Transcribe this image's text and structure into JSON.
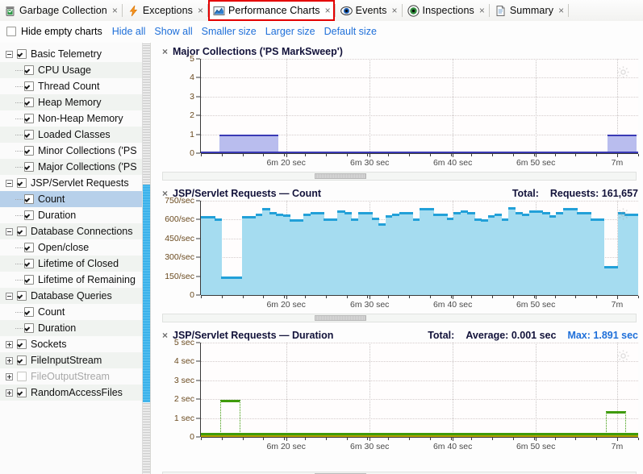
{
  "tabs": [
    {
      "label": "Garbage Collection",
      "icon": "trash-icon",
      "close": "×",
      "selected": false
    },
    {
      "label": "Exceptions",
      "icon": "bolt-icon",
      "close": "×",
      "selected": false
    },
    {
      "label": "Performance Charts",
      "icon": "chart-icon",
      "close": "×",
      "selected": true
    },
    {
      "label": "Events",
      "icon": "eye-icon",
      "close": "×",
      "selected": false
    },
    {
      "label": "Inspections",
      "icon": "eye-green-icon",
      "close": "×",
      "selected": false
    },
    {
      "label": "Summary",
      "icon": "document-icon",
      "close": "×",
      "selected": false
    }
  ],
  "toolbar": {
    "hide_empty_label": "Hide empty charts",
    "hide_empty_checked": false,
    "links": [
      "Hide all",
      "Show all",
      "Smaller size",
      "Larger size",
      "Default size"
    ]
  },
  "sidebar": {
    "rows": [
      {
        "label": "Basic Telemetry",
        "indent": 0,
        "twisty": "minus",
        "checked": true,
        "selected": false,
        "disabled": false
      },
      {
        "label": "CPU Usage",
        "indent": 1,
        "twisty": "none",
        "checked": true,
        "selected": false,
        "disabled": false
      },
      {
        "label": "Thread Count",
        "indent": 1,
        "twisty": "none",
        "checked": true,
        "selected": false,
        "disabled": false
      },
      {
        "label": "Heap Memory",
        "indent": 1,
        "twisty": "none",
        "checked": true,
        "selected": false,
        "disabled": false
      },
      {
        "label": "Non-Heap Memory",
        "indent": 1,
        "twisty": "none",
        "checked": true,
        "selected": false,
        "disabled": false
      },
      {
        "label": "Loaded Classes",
        "indent": 1,
        "twisty": "none",
        "checked": true,
        "selected": false,
        "disabled": false
      },
      {
        "label": "Minor Collections ('PS",
        "indent": 1,
        "twisty": "none",
        "checked": true,
        "selected": false,
        "disabled": false
      },
      {
        "label": "Major Collections ('PS",
        "indent": 1,
        "twisty": "none",
        "checked": true,
        "selected": false,
        "disabled": false
      },
      {
        "label": "JSP/Servlet Requests",
        "indent": 0,
        "twisty": "minus",
        "checked": true,
        "selected": false,
        "disabled": false
      },
      {
        "label": "Count",
        "indent": 1,
        "twisty": "none",
        "checked": true,
        "selected": true,
        "disabled": false
      },
      {
        "label": "Duration",
        "indent": 1,
        "twisty": "none",
        "checked": true,
        "selected": false,
        "disabled": false
      },
      {
        "label": "Database Connections",
        "indent": 0,
        "twisty": "minus",
        "checked": true,
        "selected": false,
        "disabled": false
      },
      {
        "label": "Open/close",
        "indent": 1,
        "twisty": "none",
        "checked": true,
        "selected": false,
        "disabled": false
      },
      {
        "label": "Lifetime of Closed",
        "indent": 1,
        "twisty": "none",
        "checked": true,
        "selected": false,
        "disabled": false
      },
      {
        "label": "Lifetime of Remaining",
        "indent": 1,
        "twisty": "none",
        "checked": true,
        "selected": false,
        "disabled": false
      },
      {
        "label": "Database Queries",
        "indent": 0,
        "twisty": "minus",
        "checked": true,
        "selected": false,
        "disabled": false
      },
      {
        "label": "Count",
        "indent": 1,
        "twisty": "none",
        "checked": true,
        "selected": false,
        "disabled": false
      },
      {
        "label": "Duration",
        "indent": 1,
        "twisty": "none",
        "checked": true,
        "selected": false,
        "disabled": false
      },
      {
        "label": "Sockets",
        "indent": 0,
        "twisty": "plus",
        "checked": true,
        "selected": false,
        "disabled": false
      },
      {
        "label": "FileInputStream",
        "indent": 0,
        "twisty": "plus",
        "checked": true,
        "selected": false,
        "disabled": false
      },
      {
        "label": "FileOutputStream",
        "indent": 0,
        "twisty": "plus",
        "checked": false,
        "selected": false,
        "disabled": true
      },
      {
        "label": "RandomAccessFiles",
        "indent": 0,
        "twisty": "plus",
        "checked": true,
        "selected": false,
        "disabled": false
      }
    ]
  },
  "chart_data": [
    {
      "type": "bar",
      "title": "Major Collections ('PS MarkSweep')",
      "close_icon": "×",
      "gear_icon": "gear-icon",
      "header_right": [],
      "xlabel": "",
      "ylabel": "",
      "ylim": [
        0,
        5
      ],
      "yticks": [
        0,
        1,
        2,
        3,
        4,
        5
      ],
      "ytick_labels": [
        "0",
        "1",
        "2",
        "3",
        "4",
        "5"
      ],
      "xticks_labels": [
        "6m 20 sec",
        "6m 30 sec",
        "6m 40 sec",
        "6m 50 sec",
        "7m"
      ],
      "xtick_positions_pct": [
        19.5,
        38.6,
        57.6,
        76.6,
        95.2
      ],
      "grid": true,
      "series_color": "#b9bdee",
      "series_edge_color": "#3a3ab5",
      "bars": [
        {
          "x_pct": 4.3,
          "w_pct": 13.5,
          "value": 1
        },
        {
          "x_pct": 93.0,
          "w_pct": 6.6,
          "value": 1
        }
      ],
      "baseline_value": 0
    },
    {
      "type": "area",
      "title": "JSP/Servlet Requests — Count",
      "close_icon": "×",
      "gear_icon": "gear-icon",
      "header_right": [
        {
          "text": "Total:",
          "style": "plain"
        },
        {
          "text": "Requests: 161,657",
          "style": "plain"
        }
      ],
      "xlabel": "",
      "ylabel": "",
      "ylim": [
        0,
        750
      ],
      "yticks": [
        0,
        150,
        300,
        450,
        600,
        750
      ],
      "ytick_labels": [
        "0",
        "150/sec",
        "300/sec",
        "450/sec",
        "600/sec",
        "750/sec"
      ],
      "xticks_labels": [
        "6m 20 sec",
        "6m 30 sec",
        "6m 40 sec",
        "6m 50 sec",
        "7m"
      ],
      "xtick_positions_pct": [
        19.5,
        38.6,
        57.6,
        76.6,
        95.2
      ],
      "grid": true,
      "series_color": "#a5dcf0",
      "series_edge_color": "#22a0d8",
      "values": [
        630,
        630,
        612,
        150,
        150,
        150,
        630,
        630,
        648,
        690,
        660,
        648,
        640,
        600,
        600,
        648,
        660,
        660,
        612,
        612,
        672,
        660,
        612,
        660,
        660,
        618,
        570,
        636,
        648,
        660,
        660,
        612,
        690,
        690,
        648,
        648,
        618,
        660,
        672,
        660,
        612,
        600,
        636,
        648,
        612,
        696,
        660,
        648,
        672,
        672,
        660,
        636,
        660,
        690,
        690,
        660,
        660,
        612,
        612,
        228,
        228,
        660,
        648,
        648
      ],
      "baseline_value": 0
    },
    {
      "type": "line",
      "title": "JSP/Servlet Requests — Duration",
      "close_icon": "×",
      "gear_icon": "gear-icon",
      "header_right": [
        {
          "text": "Total:",
          "style": "plain"
        },
        {
          "text": "Average: 0.001 sec",
          "style": "plain"
        },
        {
          "text": "Max: 1.891 sec",
          "style": "accent"
        }
      ],
      "xlabel": "",
      "ylabel": "",
      "ylim": [
        0,
        5
      ],
      "yticks": [
        0,
        1,
        2,
        3,
        4,
        5
      ],
      "ytick_labels": [
        "0",
        "1 sec",
        "2 sec",
        "3 sec",
        "4 sec",
        "5 sec"
      ],
      "xticks_labels": [
        "6m 20 sec",
        "6m 30 sec",
        "6m 40 sec",
        "6m 50 sec",
        "7m"
      ],
      "xtick_positions_pct": [
        19.5,
        38.6,
        57.6,
        76.6,
        95.2
      ],
      "grid": true,
      "series_color": "#3f9b0b",
      "series_secondary_color": "#b3a200",
      "max_marker_value": 1.891,
      "peaks": [
        {
          "x_pct": 4.5,
          "w_pct": 4.6,
          "value": 1.891
        },
        {
          "x_pct": 92.6,
          "w_pct": 4.6,
          "value": 1.3
        }
      ],
      "baseline_value": 0.001
    }
  ],
  "scrollbars": {
    "sidebar_thumb_label": "sidebar-scroll-thumb",
    "chart_hscroll_label": "chart-horizontal-scrollbar"
  }
}
